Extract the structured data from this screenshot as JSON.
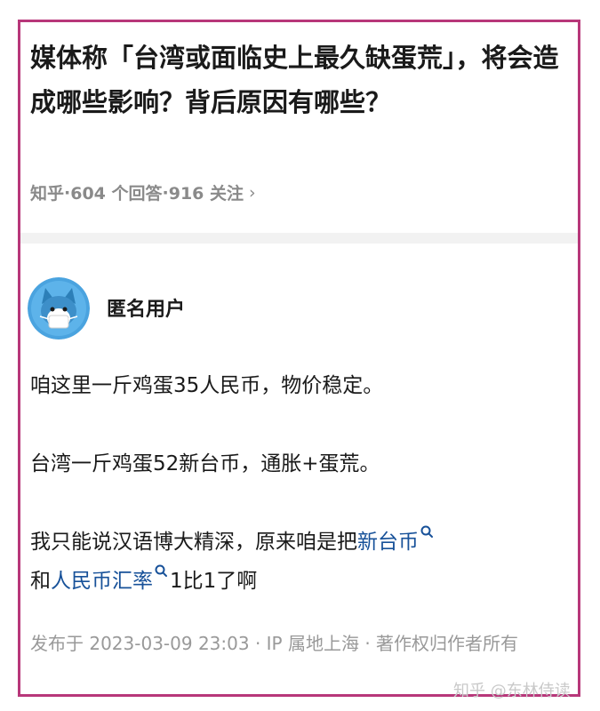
{
  "question": {
    "title": "媒体称「台湾或面临史上最久缺蛋荒」，将会造成哪些影响？背后原因有哪些？",
    "meta_source": "知乎",
    "meta_answers": "604 个回答",
    "meta_followers": "916 关注",
    "meta_sep": " · "
  },
  "answer": {
    "author": "匿名用户",
    "avatar_icon": "anonymous-fox-avatar",
    "p1": "咱这里一斤鸡蛋35人民币，物价稳定。",
    "p2": "台湾一斤鸡蛋52新台币，通胀+蛋荒。",
    "p3_a": "我只能说汉语博大精深，原来咱是把",
    "p3_link1": "新台币",
    "p3_b": "和",
    "p3_link2": "人民币汇率",
    "p3_c": "1比1了啊",
    "footer": "发布于 2023-03-09 23:03 · IP 属地上海 · 著作权归作者所有"
  },
  "watermark": "知乎 @东林侍读",
  "colors": {
    "frame": "#b8377a",
    "link": "#175199",
    "meta": "#8a8a8a"
  }
}
